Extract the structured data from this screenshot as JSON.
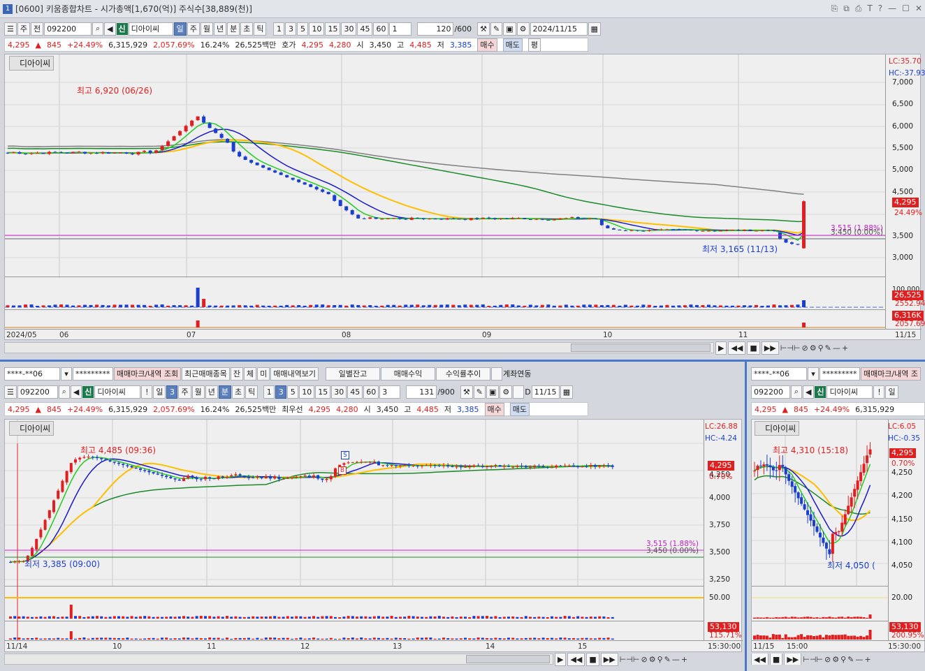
{
  "window": {
    "num": "1",
    "title": "[0600] 키움종합차트 - 시가총액[1,670(억)] 주식수[38,889(천)]"
  },
  "top": {
    "toolbar": {
      "period": "주",
      "prev": "전",
      "code": "092200",
      "sin": "신",
      "name": "디아이씨",
      "units": [
        "일",
        "주",
        "월",
        "년",
        "분",
        "초",
        "틱"
      ],
      "nums": [
        "1",
        "3",
        "5",
        "10",
        "15",
        "30",
        "45",
        "60"
      ],
      "sel_num": "1",
      "count": "120",
      "total": "/600",
      "date": "2024/11/15"
    },
    "quote": {
      "price": "4,295",
      "arrow": "▲",
      "change": "845",
      "pct": "+24.49%",
      "volume": "6,315,929",
      "vol_pct": "2,057.69%",
      "turnover": "16.24%",
      "amount": "26,525백만",
      "ask_label": "호가",
      "ask": "4,295",
      "bid": "4,280",
      "open_label": "시",
      "open": "3,450",
      "high_label": "고",
      "high": "4,485",
      "low_label": "저",
      "low": "3,385",
      "buy": "매수",
      "sell": "매도",
      "eval": "평"
    },
    "chart": {
      "name": "디아이씨",
      "lc": "LC:35.70",
      "hc": "HC:-37.93",
      "yticks": [
        "7,000",
        "6,500",
        "6,000",
        "5,500",
        "5,000",
        "4,500",
        "3,500",
        "3,000"
      ],
      "price": "4,295",
      "pct": "24.49%",
      "line1": "3,515 (1.88%)",
      "line2": "3,450 (0.00%)",
      "hi_anno": "최고 6,920 (06/26)",
      "lo_anno": "최저 3,165 (11/13)",
      "vol_top": "100,000",
      "vol_box": "26,525",
      "vol_ma": "2552.94",
      "amt_box": "6,316K",
      "amt_ma": "2057.69",
      "xlabels": [
        "2024/05",
        "06",
        "07",
        "08",
        "09",
        "10",
        "11",
        "11/15"
      ]
    }
  },
  "bl": {
    "bar1": {
      "acct": "****-**06",
      "pw": "*********",
      "b1": "매매마크/내역 조회",
      "b2": "최근매매종목",
      "b3": "잔",
      "b4": "체",
      "b5": "미",
      "b6": "매매내역보기",
      "b7": "일별잔고",
      "b8": "매매수익",
      "b9": "수익률추이",
      "b10": "계좌연동"
    },
    "toolbar": {
      "code": "092200",
      "sin": "신",
      "name": "디아이씨",
      "excl": "!",
      "units": [
        "일",
        "3",
        "주",
        "월",
        "년",
        "분",
        "초",
        "틱"
      ],
      "nums": [
        "1",
        "3",
        "5",
        "10",
        "15",
        "30",
        "45",
        "60"
      ],
      "sel": "3",
      "count": "131",
      "total": "/900",
      "d": "D",
      "date": "11/15"
    },
    "quote": {
      "price": "4,295",
      "arrow": "▲",
      "change": "845",
      "pct": "+24.49%",
      "volume": "6,315,929",
      "vol_pct": "2,057.69%",
      "turnover": "16.24%",
      "amount": "26,525백만",
      "ask_label": "최우선",
      "ask": "4,295",
      "bid": "4,280",
      "open_label": "시",
      "open": "3,450",
      "high_label": "고",
      "high": "4,485",
      "low_label": "저",
      "low": "3,385",
      "buy": "매수",
      "sell": "매도"
    },
    "chart": {
      "name": "디아이씨",
      "lc": "LC:26.88",
      "hc": "HC:-4.24",
      "yticks": [
        "4,250",
        "4,000",
        "3,750",
        "3,500",
        "3,250"
      ],
      "price": "4,295",
      "pct": "0.70%",
      "line1": "3,515 (1.88%)",
      "line2": "3,450 (0.00%)",
      "hi_anno": "최고 4,485 (09:36)",
      "lo_anno": "최저 3,385 (09:00)",
      "rsi": "50.00",
      "vol_box": "53,130",
      "vol_pct": "115.71%",
      "xlabels": [
        "11/14",
        "10",
        "11",
        "12",
        "13",
        "14",
        "15",
        "15:30:00"
      ],
      "s_mark": "S",
      "b_mark": "B"
    }
  },
  "br": {
    "bar1": {
      "acct": "****-**06",
      "pw": "*********",
      "b1": "매매마크/내역 조"
    },
    "toolbar": {
      "code": "092200",
      "sin": "신",
      "name": "디아이씨",
      "excl": "!",
      "unit": "일"
    },
    "quote": {
      "price": "4,295",
      "arrow": "▲",
      "change": "845",
      "pct": "+24.49%",
      "volume": "6,315,929"
    },
    "chart": {
      "name": "디아이씨",
      "lc": "LC:6.05",
      "hc": "HC:-0.35",
      "yticks": [
        "4,250",
        "4,200",
        "4,150",
        "4,100",
        "4,050"
      ],
      "price": "4,295",
      "pct": "0.70%",
      "hi_anno": "최고 4,310 (15:18)",
      "lo_anno": "최저 4,050 (",
      "rsi": "20.00",
      "vol_box": "53,130",
      "vol_pct": "200.95%",
      "xlabels": [
        "11/15",
        "15:00",
        "15:30:00"
      ]
    }
  },
  "colors": {
    "up": "#e02020",
    "down": "#1a3fcf",
    "ma5": "#22cc22",
    "ma10": "#1a1acc",
    "ma20": "#ffbf00",
    "ma60": "#1a8a2a",
    "ma120": "#808080",
    "magenta": "#d020d0"
  }
}
